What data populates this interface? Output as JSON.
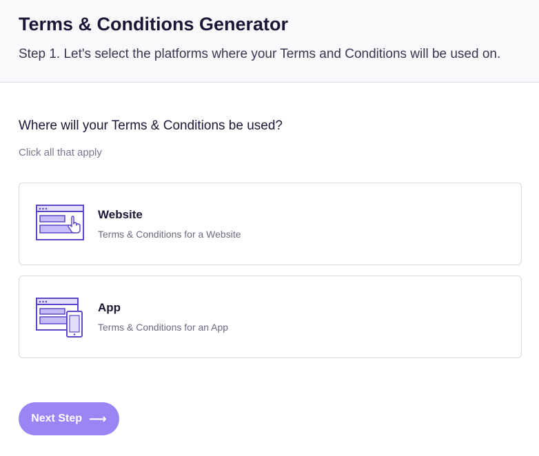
{
  "header": {
    "title": "Terms & Conditions Generator",
    "step": "Step 1. Let's select the platforms where your Terms and Conditions will be used on."
  },
  "main": {
    "question": "Where will your Terms & Conditions be used?",
    "hint": "Click all that apply",
    "options": [
      {
        "title": "Website",
        "description": "Terms & Conditions for a Website",
        "icon": "website-icon"
      },
      {
        "title": "App",
        "description": "Terms & Conditions for an App",
        "icon": "app-icon"
      }
    ]
  },
  "footer": {
    "next_label": "Next Step",
    "next_arrow": "⟶"
  },
  "colors": {
    "accent": "#9b85f5",
    "icon_stroke": "#5b45c9",
    "icon_fill": "#c9bcfa"
  }
}
